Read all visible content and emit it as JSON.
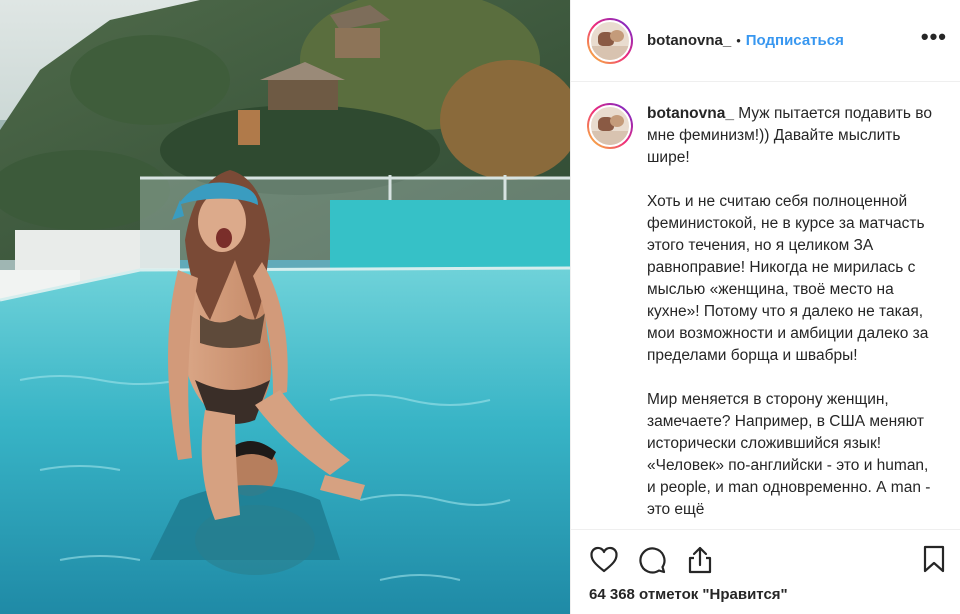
{
  "header": {
    "username": "botanovna_",
    "separator": "•",
    "follow_label": "Подписаться",
    "more_label": "•••"
  },
  "caption": {
    "username": "botanovna_",
    "paragraphs": [
      "Муж пытается подавить во мне феминизм!)) Давайте мыслить шире!",
      "Хоть и не считаю себя полноценной феминистокой, не в курсе за матчасть этого течения, но я целиком ЗА равноправие! Никогда не мирилась с мыслью «женщина, твоё место на кухне»! Потому что я далеко не такая, мои возможности и амбиции далеко за пределами борща и швабры!",
      "Мир меняется в сторону женщин, замечаете? Например, в США меняют исторически сложившийся язык! «Человек» по-английски - это и human, и people, и man одновременно. А man - это ещё"
    ]
  },
  "actions": {
    "icons": [
      "heart-icon",
      "comment-icon",
      "share-icon",
      "bookmark-icon"
    ],
    "likes_text": "64 368 отметок \"Нравится\""
  },
  "colors": {
    "link": "#3897f0",
    "text": "#262626",
    "divider": "#efefef",
    "pool": "#2a9bb3"
  }
}
